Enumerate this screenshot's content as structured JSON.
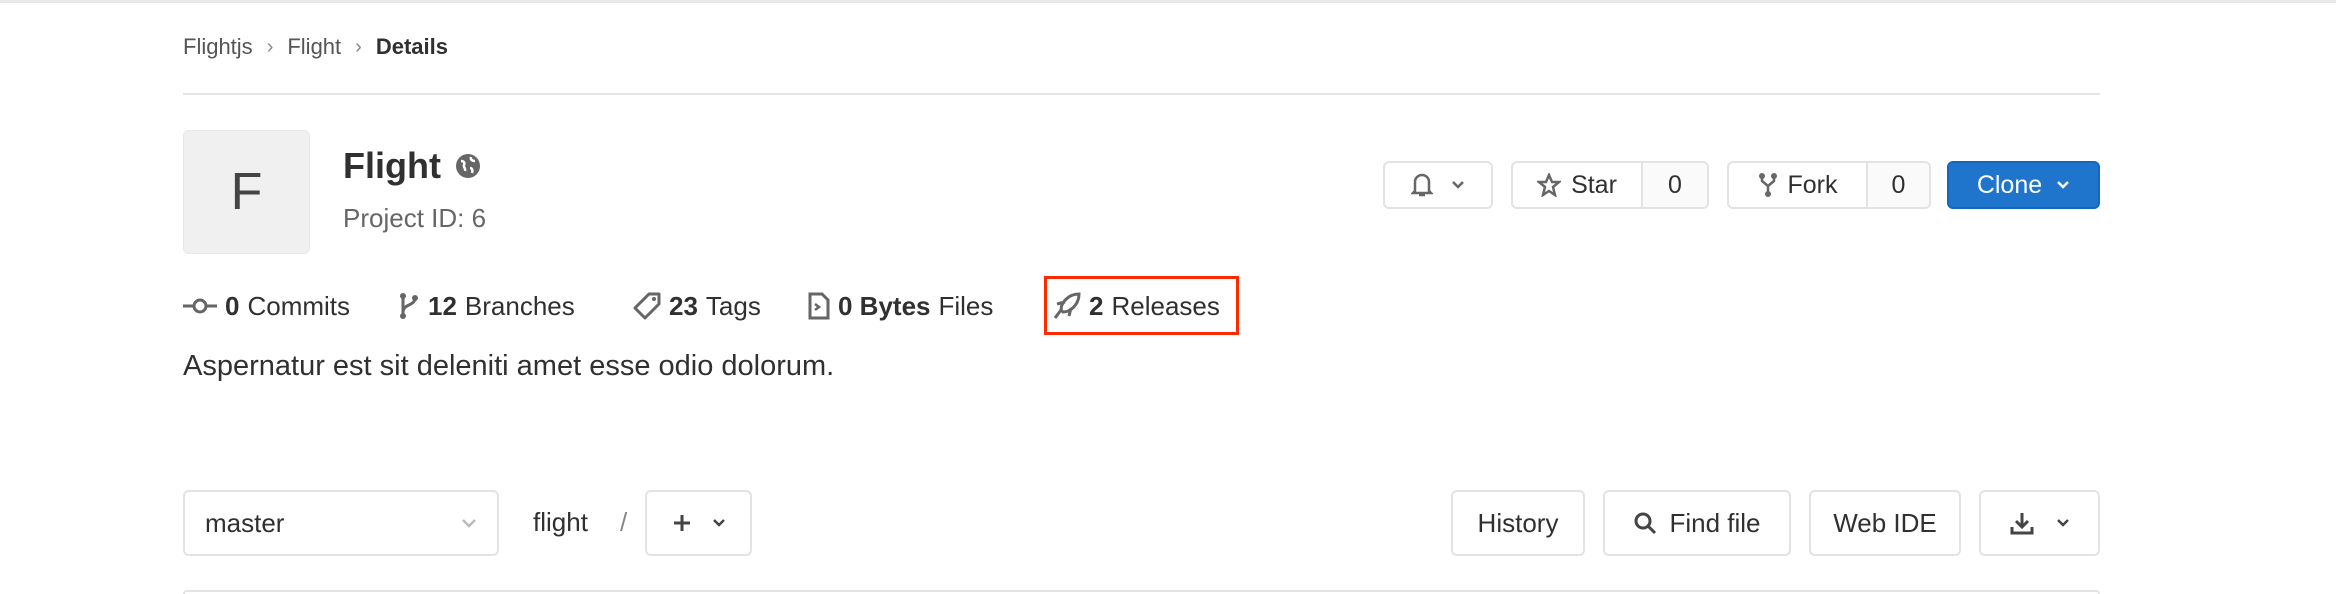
{
  "breadcrumb": [
    "Flightjs",
    "Flight",
    "Details"
  ],
  "project": {
    "avatar_letter": "F",
    "name": "Flight",
    "visibility_icon": "globe-icon",
    "id_label": "Project ID: 6"
  },
  "actions": {
    "notifications_icon": "bell-icon",
    "star_label": "Star",
    "star_count": "0",
    "fork_label": "Fork",
    "fork_count": "0",
    "clone_label": "Clone"
  },
  "stats": [
    {
      "count": "0",
      "label": "Commits",
      "icon": "commit-icon"
    },
    {
      "count": "12",
      "label": "Branches",
      "icon": "branch-icon"
    },
    {
      "count": "23",
      "label": "Tags",
      "icon": "tag-icon"
    },
    {
      "count": "0 Bytes",
      "label": "Files",
      "icon": "file-icon"
    },
    {
      "count": "2",
      "label": "Releases",
      "icon": "rocket-icon",
      "highlighted": true
    }
  ],
  "description": "Aspernatur est sit deleniti amet esse odio dolorum.",
  "repo_bar": {
    "branch": "master",
    "path": "flight",
    "separator": "/",
    "history": "History",
    "find_file": "Find file",
    "web_ide": "Web IDE"
  },
  "colors": {
    "primary": "#1f75cb",
    "highlight": "#ff2a00"
  }
}
